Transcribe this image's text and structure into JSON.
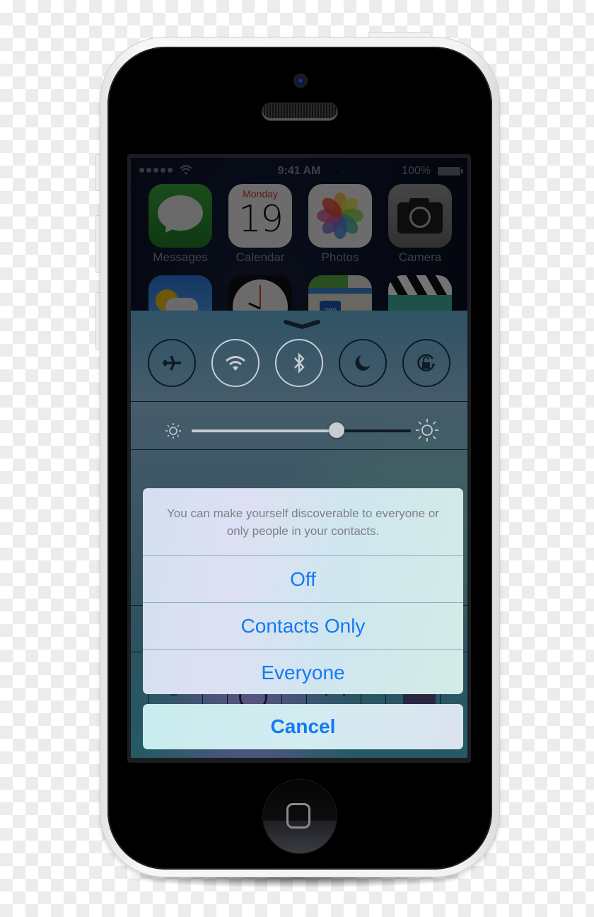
{
  "status_bar": {
    "signal_dots": 5,
    "time": "9:41 AM",
    "battery_percent": "100%",
    "icons": [
      "signal-icon",
      "wifi-icon",
      "battery-icon"
    ]
  },
  "home_screen": {
    "apps": [
      {
        "label": "Messages",
        "icon": "messages-icon"
      },
      {
        "label": "Calendar",
        "icon": "calendar-icon",
        "day": "Monday",
        "date": "19"
      },
      {
        "label": "Photos",
        "icon": "photos-icon"
      },
      {
        "label": "Camera",
        "icon": "camera-icon"
      },
      {
        "label": "",
        "icon": "weather-icon"
      },
      {
        "label": "",
        "icon": "clock-icon"
      },
      {
        "label": "",
        "icon": "maps-icon",
        "badge": "280"
      },
      {
        "label": "",
        "icon": "videos-icon"
      }
    ]
  },
  "control_center": {
    "toggles": [
      {
        "name": "airplane-mode",
        "icon": "airplane-icon",
        "state": "off"
      },
      {
        "name": "wifi",
        "icon": "wifi-icon",
        "state": "on"
      },
      {
        "name": "bluetooth",
        "icon": "bluetooth-icon",
        "state": "on"
      },
      {
        "name": "do-not-disturb",
        "icon": "moon-icon",
        "state": "off"
      },
      {
        "name": "rotation-lock",
        "icon": "rotation-lock-icon",
        "state": "off"
      }
    ],
    "brightness": {
      "value": 0.66,
      "min_icon": "sun-small-icon",
      "max_icon": "sun-large-icon"
    },
    "launchers": [
      "flashlight-icon",
      "clock-icon",
      "calculator-icon",
      "camera-icon"
    ]
  },
  "action_sheet": {
    "message": "You can make yourself discoverable to everyone or only people in your contacts.",
    "options": [
      "Off",
      "Contacts Only",
      "Everyone"
    ],
    "cancel_label": "Cancel",
    "accent_color": "#1479f4"
  }
}
